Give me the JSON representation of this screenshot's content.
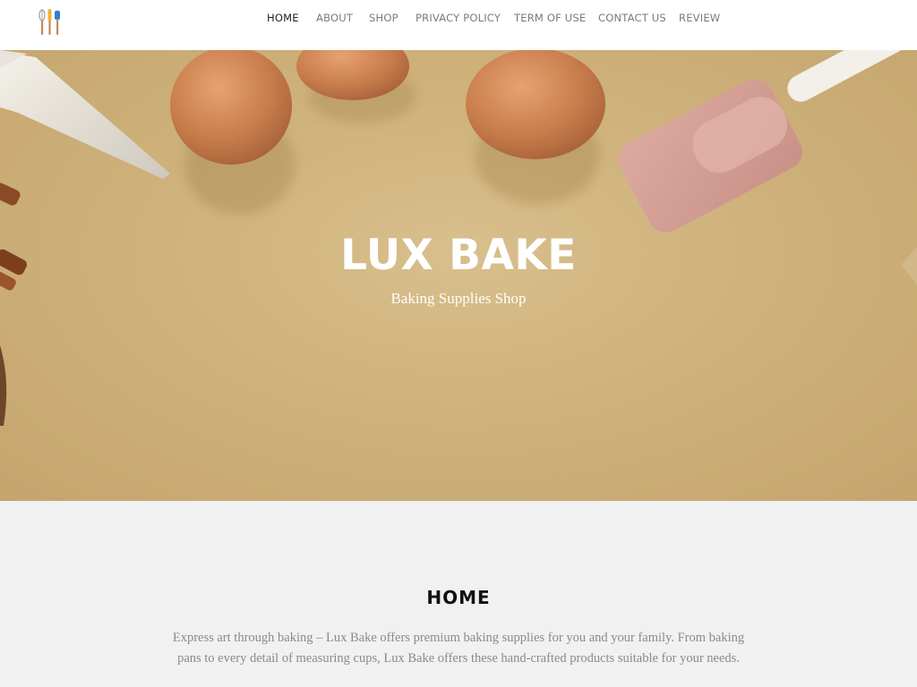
{
  "logo": {
    "icon": "baking-utensils-logo-icon"
  },
  "nav": {
    "items": [
      {
        "label": "HOME",
        "active": true
      },
      {
        "label": "ABOUT",
        "active": false
      },
      {
        "label": "SHOP",
        "active": false
      },
      {
        "label": "PRIVACY POLICY",
        "active": false
      },
      {
        "label": "TERM OF USE",
        "active": false
      },
      {
        "label": "CONTACT US",
        "active": false
      },
      {
        "label": "REVIEW",
        "active": false
      }
    ]
  },
  "hero": {
    "title": "LUX BAKE",
    "subtitle": "Baking Supplies Shop"
  },
  "main": {
    "section_title": "HOME",
    "body": "Express art through baking – Lux Bake offers premium baking supplies for you and your family. From baking pans to every detail of measuring cups, Lux Bake offers these hand-crafted products suitable for your needs."
  },
  "colors": {
    "header_bg": "#ffffff",
    "hero_bg": "#cfb27c",
    "content_bg": "#f1f1f1",
    "nav_active": "#222222",
    "nav_inactive": "#7a7a7a"
  }
}
